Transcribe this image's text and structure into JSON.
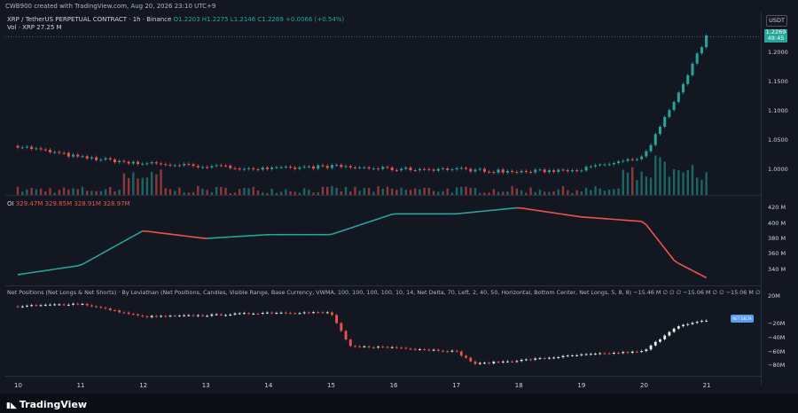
{
  "header": {
    "text": "CWB900 created with TradingView.com, Aug 20, 2026 23:10 UTC+9"
  },
  "symbol": {
    "name": "XRP / TetherUS PERPETUAL CONTRACT · 1h · Binance",
    "ohlc": "O1.2203  H1.2275  L1.2146  C1.2269  +0.0066 (+0.54%)",
    "volume": "Vol · XRP  27.25 M"
  },
  "oi": {
    "label": "OI",
    "values": "329.47M  329.85M  328.91M  328.97M"
  },
  "net_positions": {
    "label": "Net Positions (Net Longs & Net Shorts) · By Leviathan (Net Positions, Candles, Visible Range, Base Currency, VWMA, 100, 100, 100, 100, 10, 14, Net Delta, 70, Left, 2, 40, 50, Horizontal, Bottom Center, Net Longs, 5, 8, 8)",
    "readout": "−15.46 M  ∅  ∅  ∅  −15.06 M  ∅  ∅  −15.06 M  ∅  ∅  −15.06 M",
    "badge": "NET DELTA"
  },
  "price_axis": {
    "currency": "USDT",
    "last_price": "1.2269",
    "countdown": "49:45",
    "ticks": [
      "1.2000",
      "1.1500",
      "1.1000",
      "1.0500",
      "1.0000"
    ]
  },
  "oi_axis": {
    "ticks": [
      "420 M",
      "400 M",
      "380 M",
      "360 M",
      "340 M"
    ]
  },
  "np_axis": {
    "ticks": [
      "20M",
      "−20M",
      "−40M",
      "−60M",
      "−80M"
    ]
  },
  "time_axis": {
    "ticks": [
      "10",
      "11",
      "12",
      "13",
      "14",
      "15",
      "16",
      "17",
      "18",
      "19",
      "20",
      "21"
    ]
  },
  "footer": {
    "brand": "TradingView"
  },
  "colors": {
    "up": "#26a69a",
    "down": "#ef5350",
    "background": "#131722",
    "grid": "#2a2e39"
  },
  "chart_data": [
    {
      "type": "candlestick",
      "title": "XRP / TetherUS PERPETUAL CONTRACT · 1h · Binance",
      "x": [
        "10",
        "11",
        "12",
        "13",
        "14",
        "15",
        "16",
        "17",
        "18",
        "19",
        "20",
        "20.5",
        "21"
      ],
      "close": [
        1.04,
        1.02,
        1.01,
        1.005,
        1.0,
        1.005,
        1.0,
        1.0,
        0.995,
        1.0,
        1.02,
        1.12,
        1.227
      ],
      "ylim": [
        0.98,
        1.235
      ],
      "volume_spikes_x": [
        "12",
        "20",
        "20.5",
        "21"
      ]
    },
    {
      "type": "line",
      "name": "OI",
      "x": [
        "10",
        "11",
        "12",
        "13",
        "14",
        "15",
        "16",
        "17",
        "18",
        "19",
        "20",
        "20.5",
        "21"
      ],
      "values": [
        333,
        345,
        390,
        380,
        385,
        385,
        412,
        412,
        420,
        408,
        402,
        350,
        329
      ],
      "ylim": [
        326,
        425
      ]
    },
    {
      "type": "candlestick",
      "name": "Net Positions",
      "x": [
        "10",
        "11",
        "12",
        "13",
        "14",
        "15",
        "15.3",
        "16",
        "17",
        "17.3",
        "18",
        "19",
        "20",
        "20.5",
        "21"
      ],
      "close": [
        5,
        9,
        -10,
        -8,
        -4,
        -4,
        -53,
        -54,
        -60,
        -78,
        -73,
        -65,
        -60,
        -25,
        -15
      ],
      "ylim": [
        -90,
        25
      ]
    }
  ]
}
